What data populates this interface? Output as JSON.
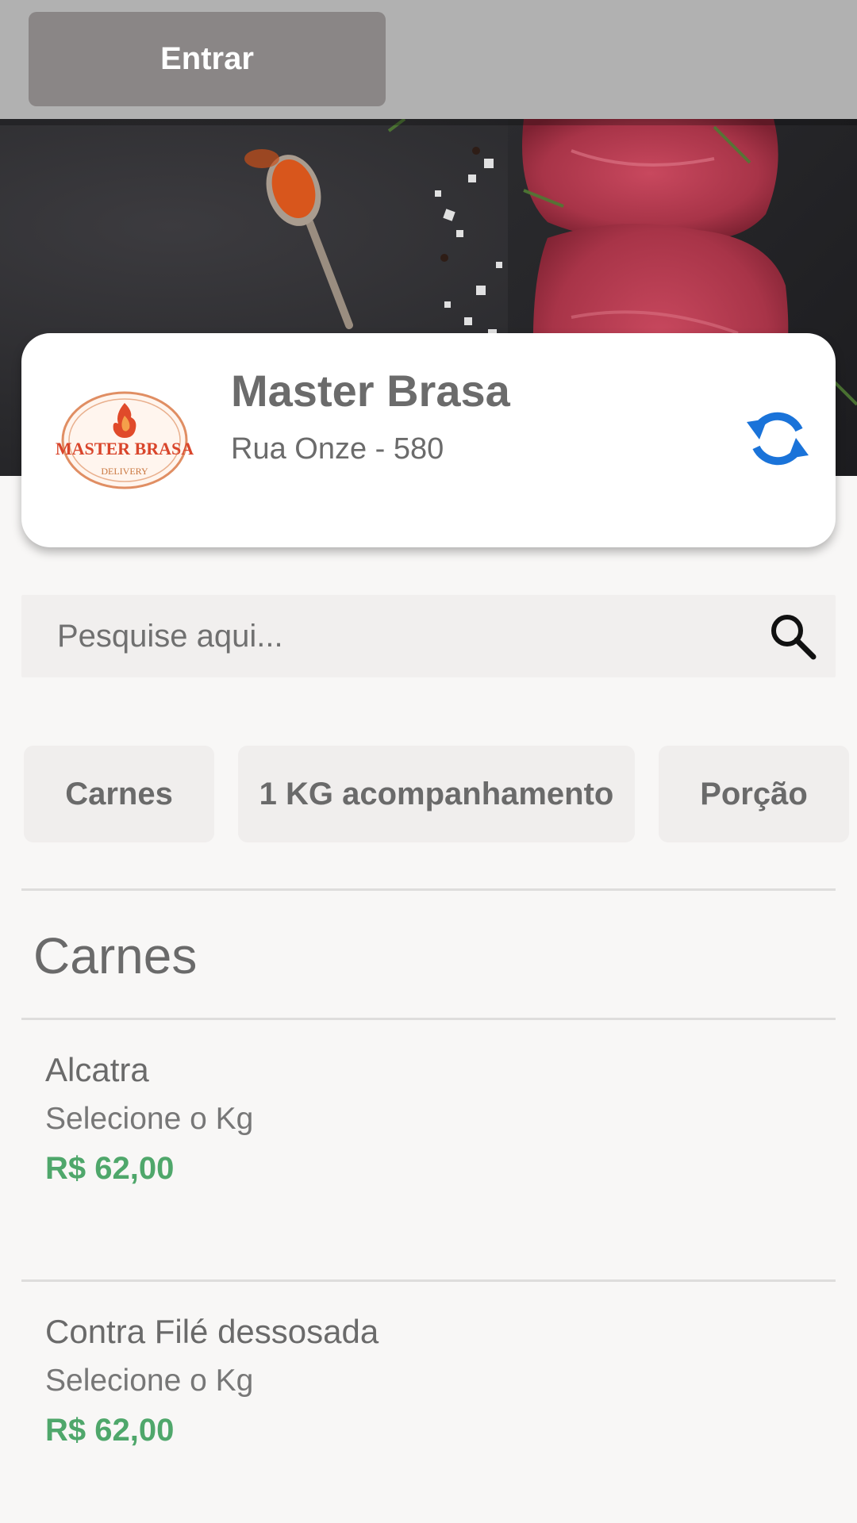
{
  "topbar": {
    "login_label": "Entrar"
  },
  "store": {
    "logo_text": "MASTER BRASA",
    "logo_subtext": "DELIVERY",
    "name": "Master Brasa",
    "address": "Rua Onze - 580"
  },
  "search": {
    "placeholder": "Pesquise aqui..."
  },
  "categories": [
    "Carnes",
    "1 KG acompanhamento",
    "Porção"
  ],
  "section": {
    "title": "Carnes"
  },
  "products": [
    {
      "name": "Alcatra",
      "description": "Selecione o Kg",
      "price": "R$ 62,00"
    },
    {
      "name": "Contra Filé dessosada",
      "description": "Selecione o Kg",
      "price": "R$ 62,00"
    }
  ],
  "colors": {
    "accent": "#1a73d9",
    "price": "#4fa76b",
    "topbar": "#b1b1b1",
    "logo_red": "#d9452b"
  },
  "icons": {
    "refresh": "refresh-icon",
    "search": "search-icon"
  }
}
